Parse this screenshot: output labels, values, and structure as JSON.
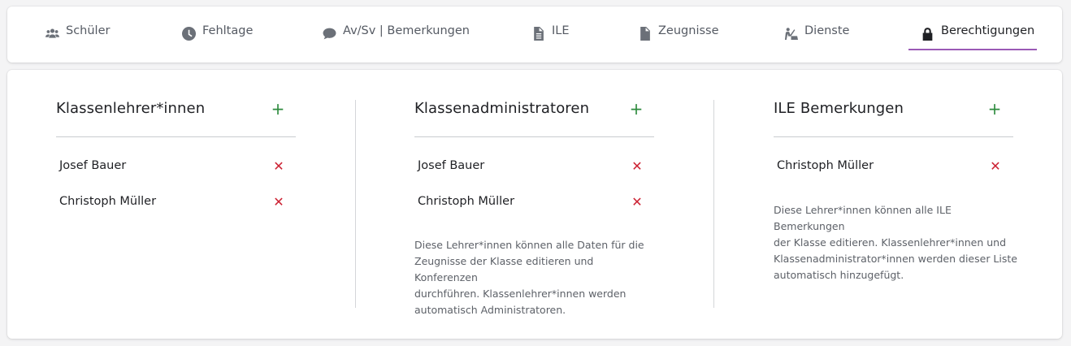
{
  "tabs": [
    {
      "label": "Schüler",
      "icon": "users-icon"
    },
    {
      "label": "Fehltage",
      "icon": "clock-icon"
    },
    {
      "label": "Av/Sv | Bemerkungen",
      "icon": "comment-icon"
    },
    {
      "label": "ILE",
      "icon": "document-icon"
    },
    {
      "label": "Zeugnisse",
      "icon": "file-icon"
    },
    {
      "label": "Dienste",
      "icon": "broom-icon"
    },
    {
      "label": "Berechtigungen",
      "icon": "lock-icon",
      "active": true
    }
  ],
  "columns": [
    {
      "title": "Klassenlehrer*innen",
      "add_label": "+",
      "people": [
        "Josef Bauer",
        "Christoph Müller"
      ],
      "note": ""
    },
    {
      "title": "Klassenadministratoren",
      "add_label": "+",
      "people": [
        "Josef Bauer",
        "Christoph Müller"
      ],
      "note_lines": [
        "Diese Lehrer*innen können alle Daten für die",
        "Zeugnisse der Klasse editieren und Konferenzen",
        "durchführen. Klassenlehrer*innen werden",
        "automatisch Administratoren."
      ]
    },
    {
      "title": "ILE Bemerkungen",
      "add_label": "+",
      "people": [
        "Christoph Müller"
      ],
      "note_lines": [
        "Diese Lehrer*innen können alle ILE Bemerkungen",
        "der Klasse editieren. Klassenlehrer*innen und",
        "Klassenadministrator*innen werden dieser Liste",
        "automatisch hinzugefügt."
      ]
    }
  ],
  "remove_label": "✕",
  "colors": {
    "accent": "#9b59b6",
    "add": "#2e8b3e",
    "remove": "#cc2233"
  }
}
